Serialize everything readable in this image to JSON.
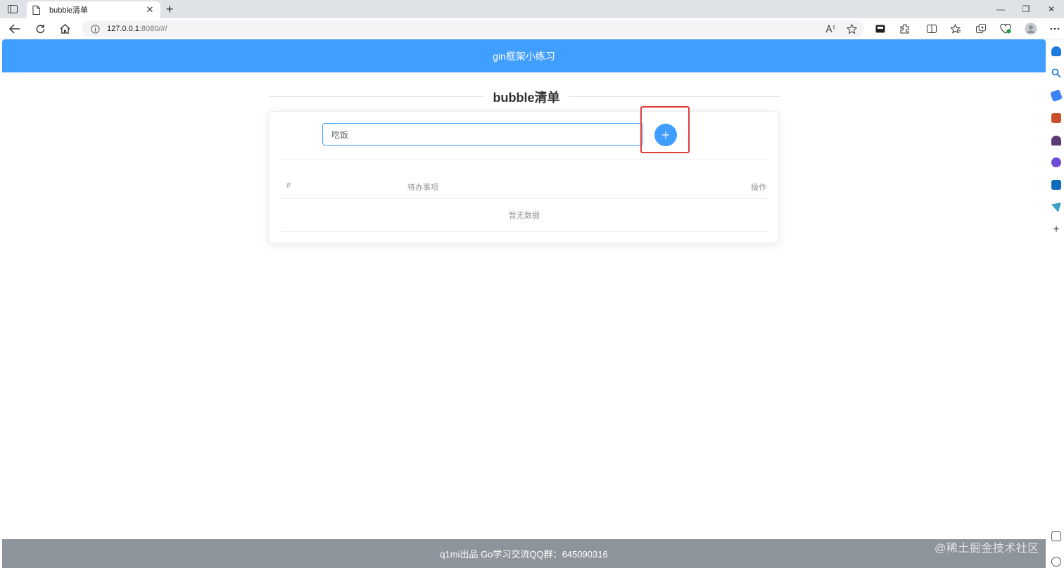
{
  "browser": {
    "tab_title": "bubble清单",
    "new_tab_label": "+",
    "url_host": "127.0.0.1",
    "url_rest": ":8080/#/",
    "window_controls": [
      "—",
      "❐",
      "✕"
    ]
  },
  "header": {
    "title": "gin框架小练习"
  },
  "section": {
    "title": "bubble清单"
  },
  "form": {
    "input_value": "吃饭",
    "add_button_icon": "plus-icon"
  },
  "table": {
    "columns": [
      "#",
      "待办事项",
      "操作"
    ],
    "empty_text": "暂无数据"
  },
  "footer": {
    "text": "q1mi出品 Go学习交流QQ群：645090316"
  },
  "watermark": {
    "text": "@稀土掘金技术社区"
  },
  "colors": {
    "primary": "#409eff",
    "highlight": "#e03c3c",
    "footer": "#8e949b"
  }
}
